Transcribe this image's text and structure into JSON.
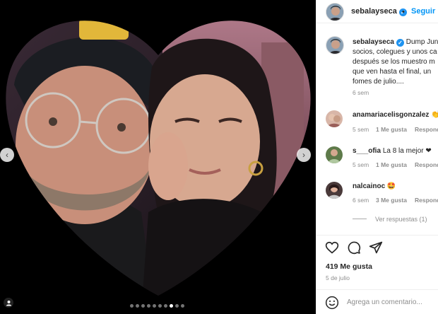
{
  "post": {
    "author": {
      "username": "sebalayseca",
      "verified": true,
      "follow_separator": "•",
      "follow_label": "Seguir"
    },
    "media": {
      "prev_icon": "chevron-left-icon",
      "next_icon": "chevron-right-icon",
      "carousel_count": 10,
      "carousel_active_index": 7,
      "tag_icon": "user-tag-icon"
    },
    "caption": {
      "lines": [
        "Dump Jun",
        "socios, colegues y unos ca",
        "después se los muestro m",
        "que ven hasta el final, un",
        "fomes de julio...."
      ],
      "time": "6 sem"
    },
    "comments": [
      {
        "username": "anamariacelisgonzalez",
        "text": "👏",
        "time": "5 sem",
        "likes": "1 Me gusta",
        "reply_label": "Respond"
      },
      {
        "username": "s___ofia",
        "text": "La 8 la mejor ❤",
        "time": "5 sem",
        "likes": "1 Me gusta",
        "reply_label": "Respond"
      },
      {
        "username": "nalcainoc",
        "text": "🤩",
        "time": "6 sem",
        "likes": "3 Me gusta",
        "reply_label": "Respond",
        "view_replies": "Ver respuestas (1)"
      }
    ],
    "actions": {
      "like_icon": "heart-icon",
      "comment_icon": "comment-icon",
      "share_icon": "share-icon"
    },
    "likes_count": "419 Me gusta",
    "date": "5 de julio",
    "comment_box": {
      "emoji_icon": "emoji-icon",
      "placeholder": "Agrega un comentario..."
    }
  },
  "colors": {
    "accent": "#0095f6",
    "verified": "#1f93f0",
    "muted": "#8e8e8e",
    "text": "#262626"
  }
}
